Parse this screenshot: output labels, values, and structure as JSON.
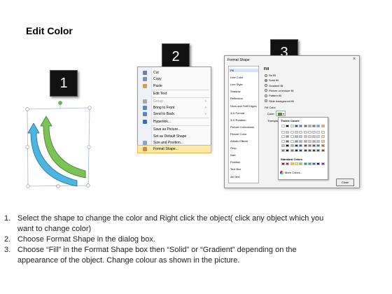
{
  "title": "Edit Color",
  "badges": [
    "1",
    "2",
    "3"
  ],
  "context_menu": {
    "items": [
      {
        "label": "Cut",
        "icon": "scissors-icon",
        "color": "#6c7fa8",
        "disabled": false,
        "submenu": false
      },
      {
        "label": "Copy",
        "icon": "copy-icon",
        "color": "#7d8fb5",
        "disabled": false,
        "submenu": false
      },
      {
        "label": "Paste",
        "icon": "paste-icon",
        "color": "#c9a24a",
        "disabled": false,
        "submenu": false
      },
      {
        "label": "Edit Text",
        "icon": "",
        "color": "",
        "disabled": false,
        "submenu": false
      },
      {
        "label": "Group",
        "icon": "group-icon",
        "color": "#a7a7a7",
        "disabled": true,
        "submenu": true
      },
      {
        "label": "Bring to Front",
        "icon": "bring-front-icon",
        "color": "#5f84c7",
        "disabled": false,
        "submenu": true
      },
      {
        "label": "Send to Back",
        "icon": "send-back-icon",
        "color": "#5f84c7",
        "disabled": false,
        "submenu": true
      },
      {
        "label": "Hyperlink...",
        "icon": "hyperlink-icon",
        "color": "#3b6bbf",
        "disabled": false,
        "submenu": false
      },
      {
        "label": "Save as Picture...",
        "icon": "",
        "color": "",
        "disabled": false,
        "submenu": false
      },
      {
        "label": "Set as Default Shape",
        "icon": "",
        "color": "",
        "disabled": false,
        "submenu": false
      },
      {
        "label": "Size and Position...",
        "icon": "size-position-icon",
        "color": "#8aa3cf",
        "disabled": false,
        "submenu": false
      },
      {
        "label": "Format Shape...",
        "icon": "format-shape-icon",
        "color": "#d08a3a",
        "disabled": false,
        "submenu": false,
        "highlighted": true
      }
    ]
  },
  "dialog": {
    "title": "Format Shape",
    "categories": [
      "Fill",
      "Line Color",
      "Line Style",
      "Shadow",
      "Reflection",
      "Glow and Soft Edges",
      "3-D Format",
      "3-D Rotation",
      "Picture Corrections",
      "Picture Color",
      "Artistic Effects",
      "Crop",
      "Size",
      "Position",
      "Text Box",
      "Alt Text"
    ],
    "pane_heading": "Fill",
    "fill_options": [
      "No fill",
      "Solid fill",
      "Gradient fill",
      "Picture or texture fill",
      "Pattern fill",
      "Slide background fill"
    ],
    "fill_selected": 1,
    "fill_color_label": "Fill Color",
    "color_label": "Color:",
    "transparency_label": "Transpar",
    "theme_colors_label": "Theme Colors",
    "standard_colors_label": "Standard Colors",
    "more_colors_label": "More Colors...",
    "close_label": "Close",
    "theme_top": [
      "#ffffff",
      "#000000",
      "#eeece1",
      "#1f497d",
      "#4f81bd",
      "#c0504d",
      "#9bbb59",
      "#8064a2",
      "#4bacc6",
      "#f79646"
    ],
    "standard": [
      "#c00000",
      "#ff0000",
      "#ffc000",
      "#ffff00",
      "#92d050",
      "#00b050",
      "#00b0f0",
      "#0070c0",
      "#002060",
      "#7030a0"
    ]
  },
  "instructions": [
    {
      "num": "1.",
      "lines": [
        "Select the shape to change the color and Right click the object( click any object which you",
        "want to change color)"
      ]
    },
    {
      "num": "2.",
      "lines": [
        "Choose Format Shape in the dialog box."
      ]
    },
    {
      "num": "3.",
      "lines": [
        "Choose “Fill” in the Format Shape box then “Solid” or “Gradient” depending on the",
        "appearance of the object. Change colour as shown in the picture."
      ]
    }
  ]
}
